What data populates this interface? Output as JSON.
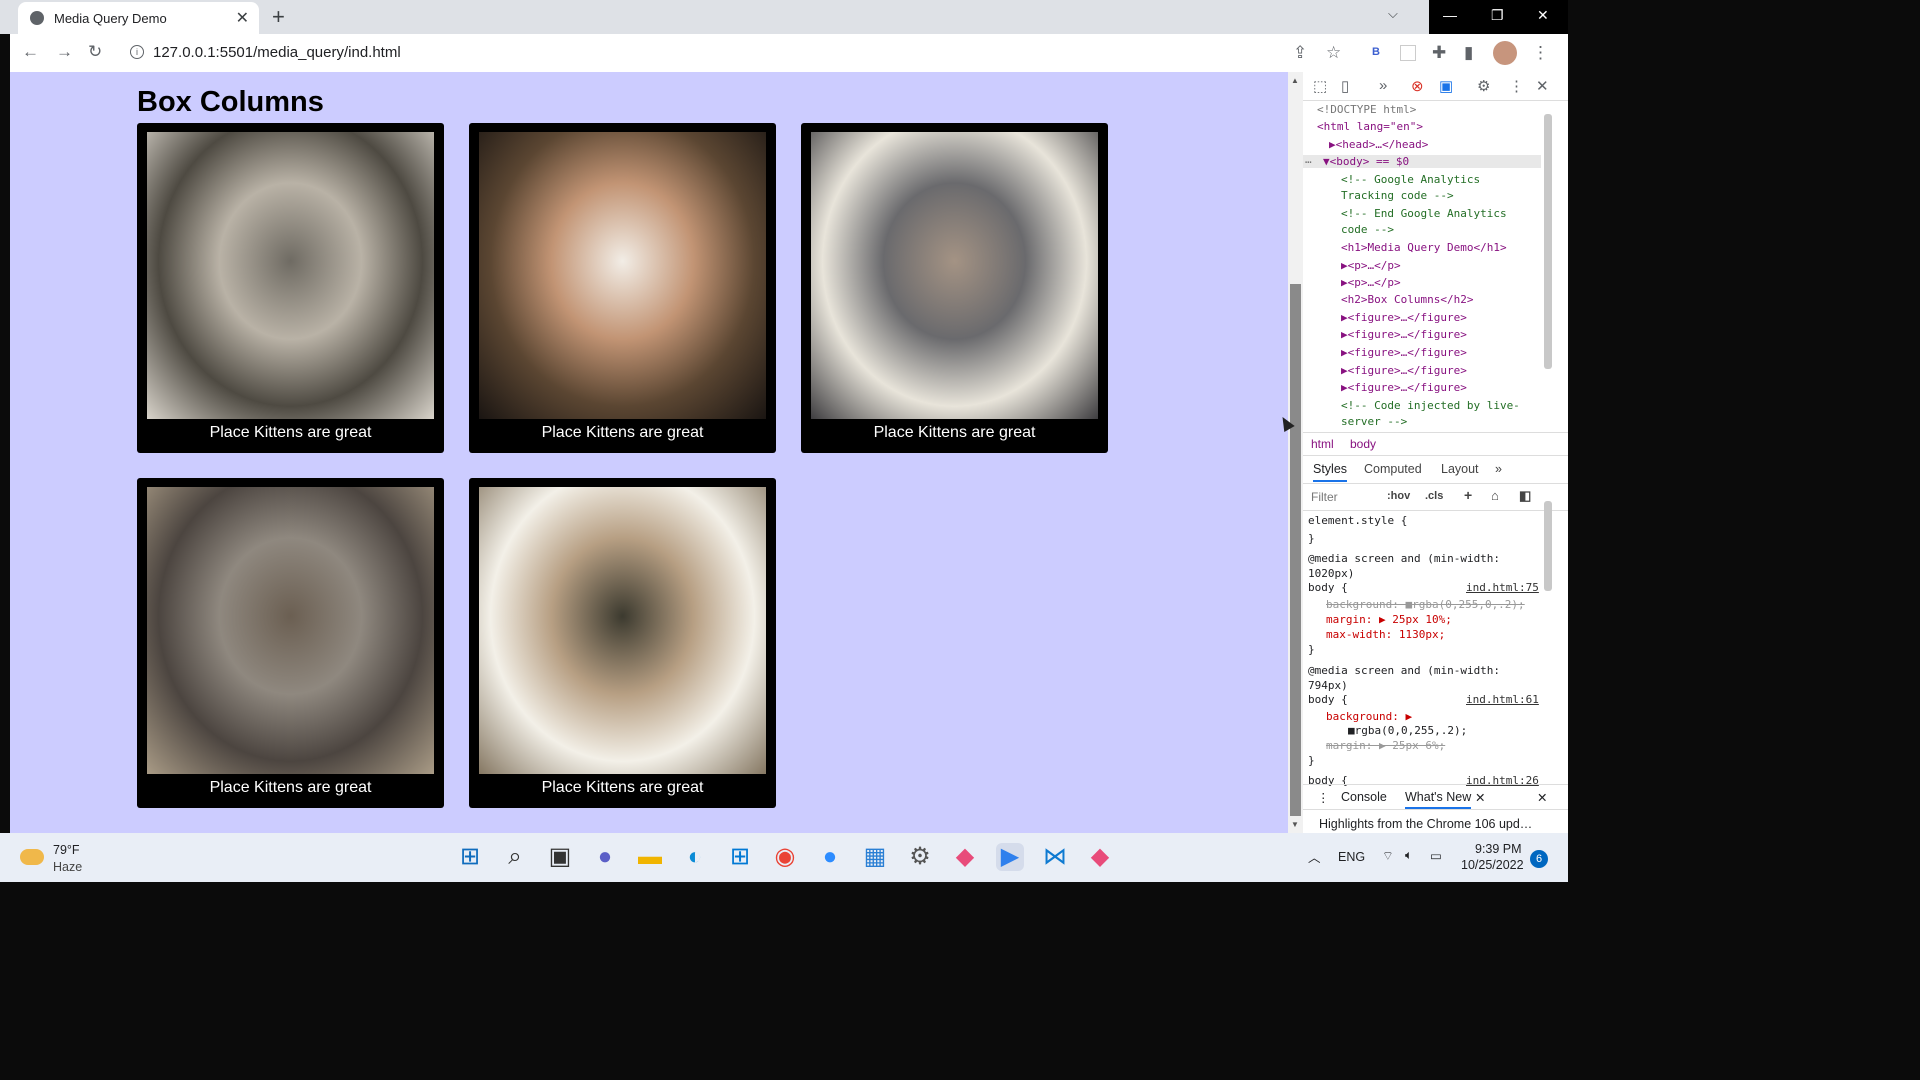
{
  "browser": {
    "tab_title": "Media Query Demo",
    "tab_close": "✕",
    "new_tab": "+",
    "tab_search": "⌵",
    "window_controls": {
      "minimize": "—",
      "maximize": "❐",
      "close": "✕"
    },
    "url": "127.0.0.1:5501/media_query/ind.html",
    "icons": [
      "back-icon",
      "forward-icon",
      "reload-icon",
      "share-icon",
      "star-icon",
      "extension-b-icon",
      "extension-blank-icon",
      "puzzle-icon",
      "sidepanel-icon",
      "avatar",
      "menu-icon"
    ],
    "ext_b": "B"
  },
  "page": {
    "heading": "Box Columns",
    "figures": [
      {
        "caption": "Place Kittens are great",
        "colors": [
          "#6f6b63",
          "#b9b2a6",
          "#4e4a42",
          "#d9d4cb"
        ]
      },
      {
        "caption": "Place Kittens are great",
        "colors": [
          "#f2ede6",
          "#c29474",
          "#5b4632",
          "#1a1512"
        ]
      },
      {
        "caption": "Place Kittens are great",
        "colors": [
          "#a49384",
          "#6a6a6d",
          "#e8e4da",
          "#3e3d40"
        ]
      },
      {
        "caption": "Place Kittens are great",
        "colors": [
          "#6b5f52",
          "#8f887f",
          "#4c4540",
          "#a99b86"
        ]
      },
      {
        "caption": "Place Kittens are great",
        "colors": [
          "#3c3a2f",
          "#b79f83",
          "#f3f0e8",
          "#857762"
        ]
      }
    ],
    "background": "#ccccff"
  },
  "devtools": {
    "dom": [
      {
        "text": "<!DOCTYPE html>",
        "cls": "gray"
      },
      {
        "text": "<html lang=\"en\">",
        "cls": "tag"
      },
      {
        "text": "▶<head>…</head>",
        "cls": "tag"
      },
      {
        "text": "▼<body> == $0",
        "cls": "tag"
      },
      {
        "text": "<!-- Google Analytics",
        "cls": "cmt"
      },
      {
        "text": "Tracking code -->",
        "cls": "cmt"
      },
      {
        "text": "<!-- End Google Analytics",
        "cls": "cmt"
      },
      {
        "text": "code -->",
        "cls": "cmt"
      },
      {
        "text": "<h1>Media Query Demo</h1>",
        "cls": "tag"
      },
      {
        "text": "▶<p>…</p>",
        "cls": "tag"
      },
      {
        "text": "▶<p>…</p>",
        "cls": "tag"
      },
      {
        "text": "<h2>Box Columns</h2>",
        "cls": "tag"
      },
      {
        "text": "▶<figure>…</figure>",
        "cls": "tag"
      },
      {
        "text": "▶<figure>…</figure>",
        "cls": "tag"
      },
      {
        "text": "▶<figure>…</figure>",
        "cls": "tag"
      },
      {
        "text": "▶<figure>…</figure>",
        "cls": "tag"
      },
      {
        "text": "▶<figure>…</figure>",
        "cls": "tag"
      },
      {
        "text": "<!-- Code injected by live-",
        "cls": "cmt"
      },
      {
        "text": "server -->",
        "cls": "cmt"
      }
    ],
    "dom_dots": "…",
    "breadcrumbs": [
      "html",
      "body"
    ],
    "tabs": [
      "Styles",
      "Computed",
      "Layout",
      "»"
    ],
    "filter_placeholder": "Filter",
    "filter_buttons": [
      ":hov",
      ".cls",
      "+"
    ],
    "styles": [
      {
        "text": "element.style {",
        "cls": ""
      },
      {
        "text": "}",
        "cls": ""
      },
      {
        "text": "@media screen and (min-width:",
        "cls": ""
      },
      {
        "text": "1020px)",
        "cls": ""
      },
      {
        "text": "body {",
        "cls": "",
        "link": "ind.html:75"
      },
      {
        "text": "background: ■rgba(0,255,0,.2);",
        "cls": "strike"
      },
      {
        "text": "margin: ▶ 25px 10%;",
        "cls": "prop"
      },
      {
        "text": "max-width: 1130px;",
        "cls": "prop"
      },
      {
        "text": "}",
        "cls": ""
      },
      {
        "text": "@media screen and (min-width:",
        "cls": ""
      },
      {
        "text": "794px)",
        "cls": ""
      },
      {
        "text": "body {",
        "cls": "",
        "link": "ind.html:61"
      },
      {
        "text": "background: ▶",
        "cls": "prop"
      },
      {
        "text": "■rgba(0,0,255,.2);",
        "cls": ""
      },
      {
        "text": "margin: ▶ 25px 6%;",
        "cls": "strike"
      },
      {
        "text": "}",
        "cls": ""
      },
      {
        "text": "body {",
        "cls": "",
        "link": "ind.html:26"
      }
    ],
    "drawer": {
      "console": "Console",
      "whats_new": "What's New",
      "close": "✕"
    },
    "highlights": "Highlights from the Chrome 106 upd…"
  },
  "taskbar": {
    "weather_temp": "79°F",
    "weather_desc": "Haze",
    "lang": "ENG",
    "time": "9:39 PM",
    "date": "10/25/2022",
    "notifications": "6",
    "apps": [
      "start",
      "search",
      "task-view",
      "teams-chat",
      "file-explorer",
      "edge",
      "store",
      "chrome",
      "zoom",
      "photos",
      "settings",
      "git",
      "media-player",
      "vscode",
      "git2"
    ]
  }
}
